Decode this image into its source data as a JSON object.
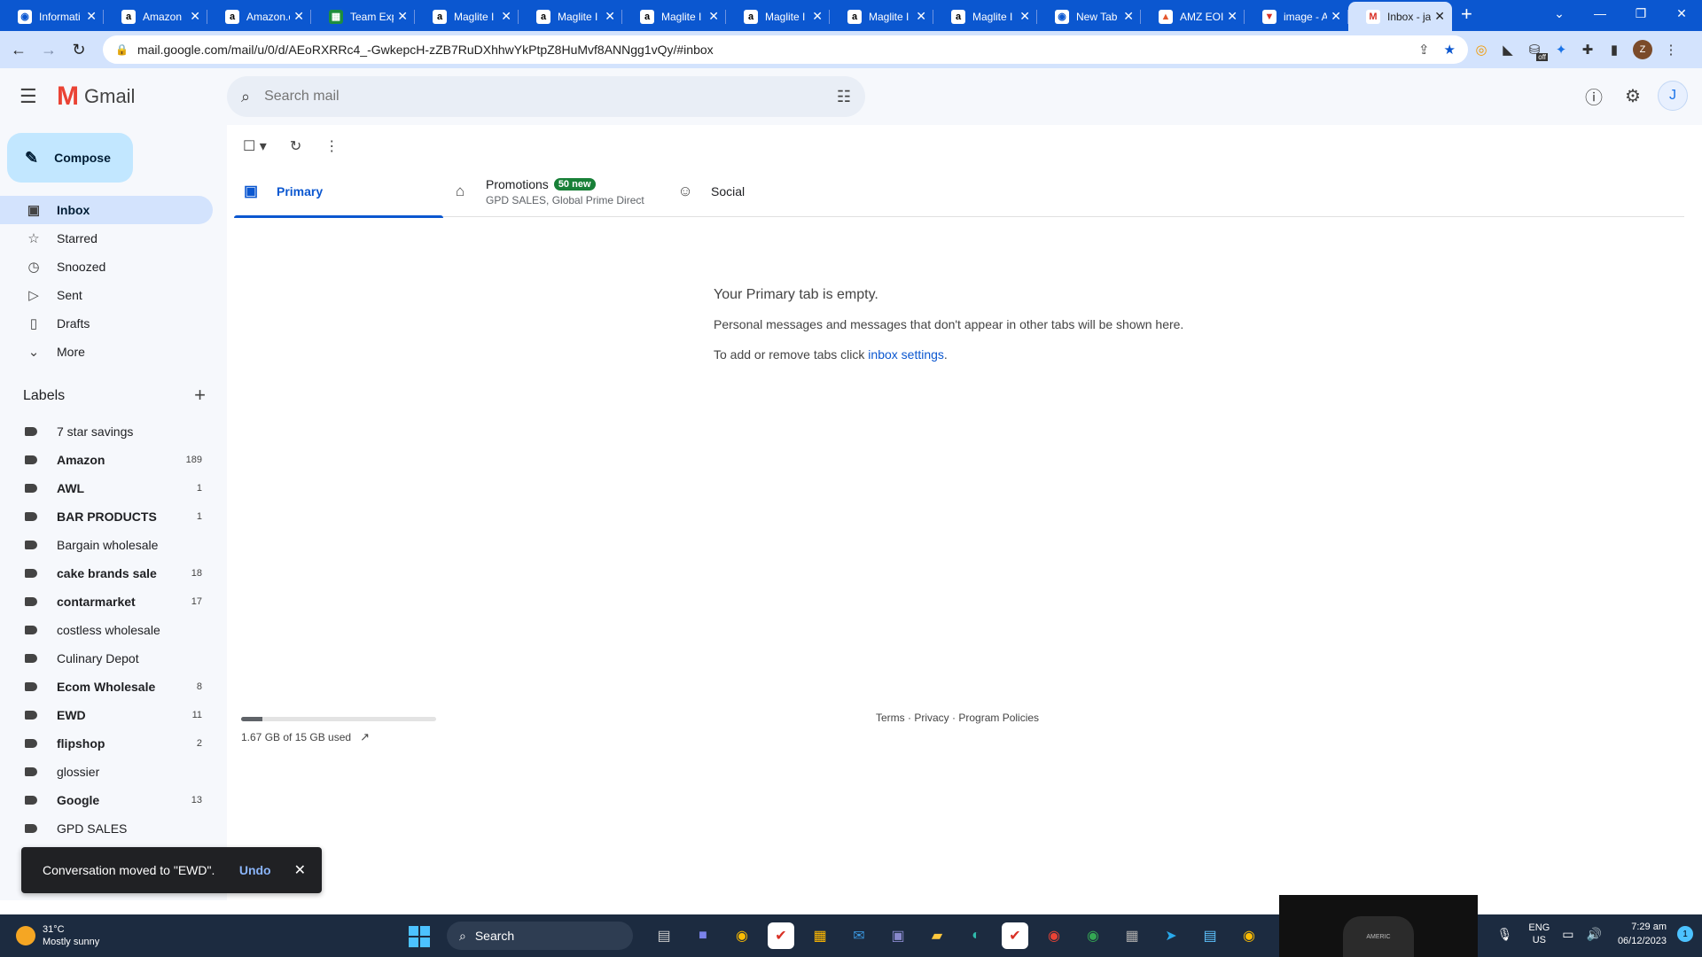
{
  "browser": {
    "tabs": [
      {
        "title": "Informati",
        "favicon": "globe-icon",
        "active": false
      },
      {
        "title": "Amazon",
        "favicon": "amazon-icon",
        "active": false
      },
      {
        "title": "Amazon.c",
        "favicon": "amazon-icon",
        "active": false
      },
      {
        "title": "Team Exp",
        "favicon": "sheets-icon",
        "active": false
      },
      {
        "title": "Maglite I",
        "favicon": "amazon-icon",
        "active": false
      },
      {
        "title": "Maglite I",
        "favicon": "amazon-icon",
        "active": false
      },
      {
        "title": "Maglite I",
        "favicon": "amazon-icon",
        "active": false
      },
      {
        "title": "Maglite I",
        "favicon": "amazon-icon",
        "active": false
      },
      {
        "title": "Maglite I",
        "favicon": "amazon-icon",
        "active": false
      },
      {
        "title": "Maglite I",
        "favicon": "amazon-icon",
        "active": false
      },
      {
        "title": "New Tab",
        "favicon": "chrome-icon",
        "active": false
      },
      {
        "title": "AMZ EOI",
        "favicon": "amzeo-icon",
        "active": false
      },
      {
        "title": "image - A",
        "favicon": "image-icon",
        "active": false
      },
      {
        "title": "Inbox - ja",
        "favicon": "gmail-icon",
        "active": true
      }
    ],
    "url": "mail.google.com/mail/u/0/d/AEoRXRRc4_-GwkepcH-zZB7RuDXhhwYkPtpZ8HuMvf8ANNgg1vQy/#inbox",
    "profile_initial": "Z",
    "extension_badge": "off"
  },
  "gmail": {
    "logo_text": "Gmail",
    "search_placeholder": "Search mail",
    "avatar_initial": "J",
    "compose_label": "Compose",
    "nav": [
      {
        "label": "Inbox",
        "icon": "inbox-icon",
        "active": true
      },
      {
        "label": "Starred",
        "icon": "star-icon",
        "active": false
      },
      {
        "label": "Snoozed",
        "icon": "clock-icon",
        "active": false
      },
      {
        "label": "Sent",
        "icon": "send-icon",
        "active": false
      },
      {
        "label": "Drafts",
        "icon": "draft-icon",
        "active": false
      },
      {
        "label": "More",
        "icon": "chevron-down-icon",
        "active": false
      }
    ],
    "labels_heading": "Labels",
    "labels": [
      {
        "name": "7 star savings",
        "count": "",
        "bold": false
      },
      {
        "name": "Amazon",
        "count": "189",
        "bold": true
      },
      {
        "name": "AWL",
        "count": "1",
        "bold": true
      },
      {
        "name": "BAR PRODUCTS",
        "count": "1",
        "bold": true
      },
      {
        "name": "Bargain wholesale",
        "count": "",
        "bold": false
      },
      {
        "name": "cake brands sale",
        "count": "18",
        "bold": true
      },
      {
        "name": "contarmarket",
        "count": "17",
        "bold": true
      },
      {
        "name": "costless wholesale",
        "count": "",
        "bold": false
      },
      {
        "name": "Culinary Depot",
        "count": "",
        "bold": false
      },
      {
        "name": "Ecom Wholesale",
        "count": "8",
        "bold": true
      },
      {
        "name": "EWD",
        "count": "11",
        "bold": true
      },
      {
        "name": "flipshop",
        "count": "2",
        "bold": true
      },
      {
        "name": "glossier",
        "count": "",
        "bold": false
      },
      {
        "name": "Google",
        "count": "13",
        "bold": true
      },
      {
        "name": "GPD SALES",
        "count": "",
        "bold": false
      }
    ],
    "tabs": {
      "primary": "Primary",
      "promotions": "Promotions",
      "promotions_badge": "50 new",
      "promotions_sub": "GPD SALES, Global Prime Direct",
      "social": "Social"
    },
    "empty": {
      "title": "Your Primary tab is empty.",
      "desc": "Personal messages and messages that don't appear in other tabs will be shown here.",
      "hint_prefix": "To add or remove tabs click ",
      "hint_link": "inbox settings",
      "hint_suffix": "."
    },
    "storage": {
      "text": "1.67 GB of 15 GB used",
      "used_fraction": 0.111
    },
    "footer": {
      "terms": "Terms",
      "privacy": "Privacy",
      "policies": "Program Policies",
      "sep": " · "
    },
    "snackbar": {
      "message": "Conversation moved to \"EWD\".",
      "undo": "Undo"
    }
  },
  "taskbar": {
    "temp": "31°C",
    "weather": "Mostly sunny",
    "search_placeholder": "Search",
    "lang_top": "ENG",
    "lang_bottom": "US",
    "time": "7:29 am",
    "date": "06/12/2023",
    "notifications": "1",
    "overlay_text": "AMERIC"
  },
  "colors": {
    "accent": "#0b57d0",
    "compose_bg": "#c2e7ff",
    "active_nav_bg": "#d3e3fd",
    "badge_green": "#188038"
  }
}
